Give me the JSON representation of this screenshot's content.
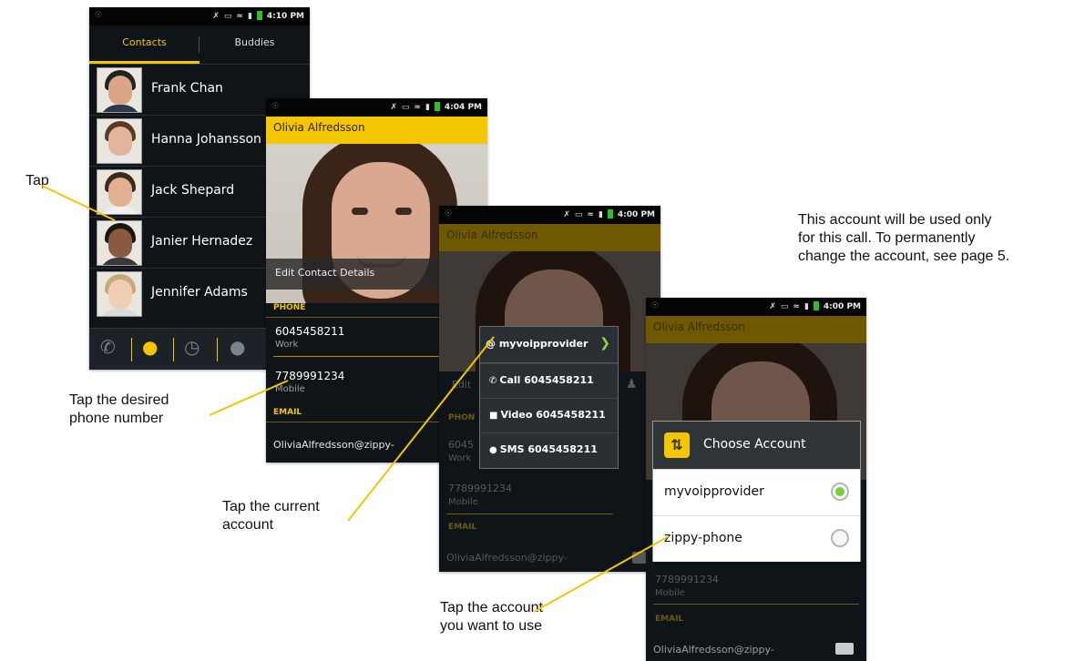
{
  "annotations": {
    "tap": "Tap",
    "tap_phone_line1": "Tap the desired",
    "tap_phone_line2": "phone number",
    "tap_current_line1": "Tap the current",
    "tap_current_line2": "account",
    "tap_use_line1": "Tap the account",
    "tap_use_line2": "you want to use",
    "note_line1": "This account will be used only",
    "note_line2": "for this call. To permanently",
    "note_line3": "change the account, see page 5."
  },
  "screen1": {
    "time": "4:10 PM",
    "tabs": [
      "Contacts",
      "Buddies"
    ],
    "contacts": [
      "Frank Chan",
      "Hanna Johansson",
      "Jack Shepard",
      "Janier Hernadez",
      "Jennifer Adams"
    ],
    "nav_icons": [
      "phone-icon",
      "contacts-icon",
      "history-icon",
      "chat-icon"
    ]
  },
  "screen2": {
    "time": "4:04 PM",
    "title": "Olivia Alfredsson",
    "edit_label": "Edit Contact Details",
    "phone_header": "PHONE",
    "phone1": "6045458211",
    "phone1_type": "Work",
    "phone2": "7789991234",
    "phone2_type": "Mobile",
    "email_header": "EMAIL",
    "email": "OliviaAlfredsson@zippy-"
  },
  "screen3": {
    "time": "4:00 PM",
    "title": "Olivia Alfredsson",
    "account_at": "@",
    "account": "myvoipprovider",
    "call": "Call 6045458211",
    "video": "Video 6045458211",
    "sms": "SMS 6045458211",
    "bg_edit": "Edit",
    "bg_phone_header": "PHON",
    "bg_phone1": "6045",
    "bg_phone1_type": "Work",
    "bg_phone2": "7789991234",
    "bg_phone2_type": "Mobile",
    "email_header": "EMAIL",
    "email": "OliviaAlfredsson@zippy-"
  },
  "screen4": {
    "time": "4:00 PM",
    "title": "Olivia Alfredsson",
    "dialog_title": "Choose Account",
    "options": [
      "myvoipprovider",
      "zippy-phone"
    ],
    "selected_index": 0,
    "phone2": "7789991234",
    "phone2_type": "Mobile",
    "email_header": "EMAIL",
    "email": "OliviaAlfredsson@zippy-"
  },
  "colors": {
    "accent": "#f3c600",
    "selected_radio": "#74d43a",
    "phone_bg": "#0f1418"
  }
}
